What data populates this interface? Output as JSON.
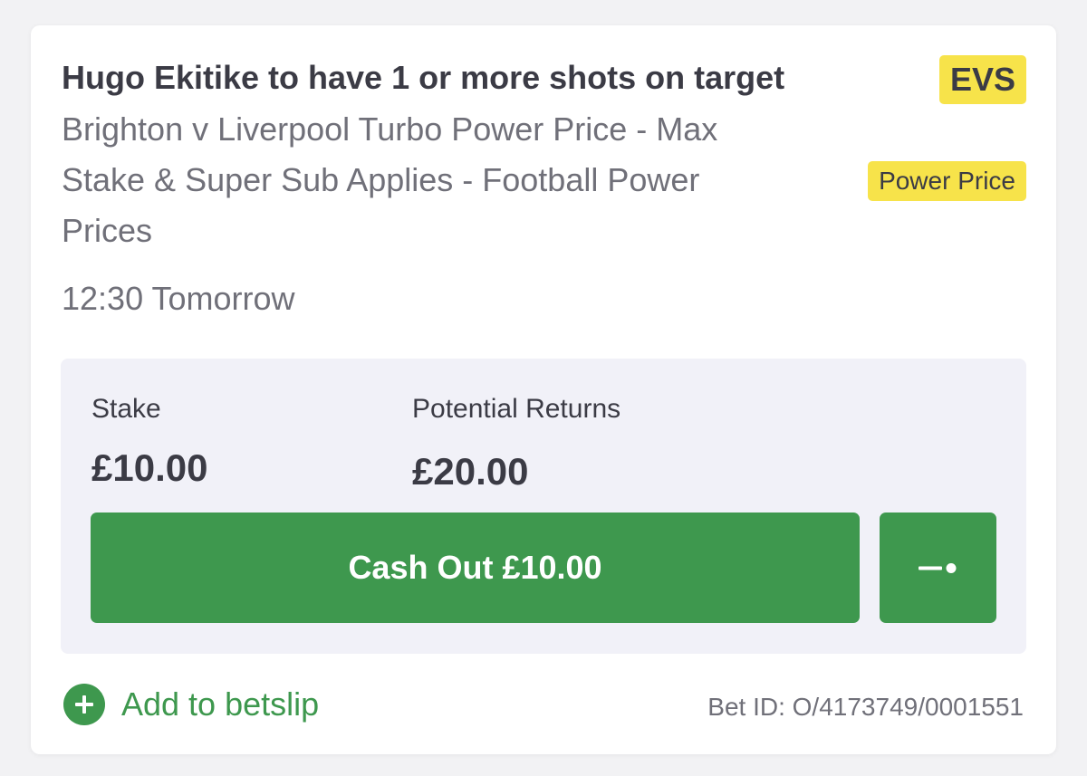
{
  "bet": {
    "selection": "Hugo Ekitike to have 1 or more shots on target",
    "odds": "EVS",
    "market": "Brighton v Liverpool Turbo Power Price - Max Stake & Super Sub Applies - Football Power Prices",
    "badge": "Power Price",
    "event_time": "12:30 Tomorrow",
    "bet_id": "Bet ID: O/4173749/0001551"
  },
  "stake_panel": {
    "stake_label": "Stake",
    "stake_value": "£10.00",
    "returns_label": "Potential Returns",
    "returns_value": "£20.00"
  },
  "actions": {
    "cash_out_label": "Cash Out £10.00",
    "partial_icon": "partial-cashout-slider-icon",
    "add_betslip_label": "Add to betslip",
    "add_icon": "plus-circle-icon"
  },
  "colors": {
    "accent_green": "#3e984e",
    "badge_yellow": "#f7e34a",
    "text_dark": "#3b3b45",
    "text_muted": "#707079",
    "panel_bg": "#f1f1f8"
  }
}
